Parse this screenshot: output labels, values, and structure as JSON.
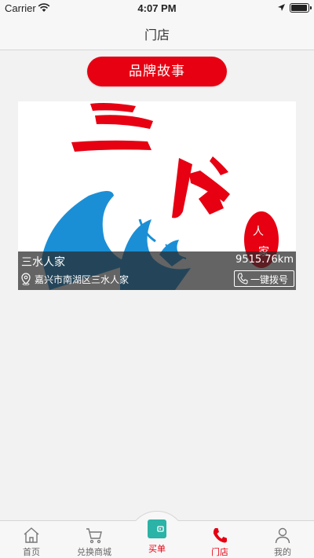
{
  "status_bar": {
    "carrier": "Carrier",
    "time": "4:07 PM"
  },
  "nav": {
    "title": "门店"
  },
  "brand_story_button": "品牌故事",
  "store": {
    "name": "三水人家",
    "distance": "9515.76km",
    "address": "嘉兴市南湖区三水人家",
    "call_label": "一键拨号",
    "logo_text": {
      "main": "三水",
      "seal": "人家"
    }
  },
  "tabs": [
    {
      "label": "首页",
      "icon": "home-icon"
    },
    {
      "label": "兑换商城",
      "icon": "cart-icon"
    },
    {
      "label": "买单",
      "icon": "wallet-icon"
    },
    {
      "label": "门店",
      "icon": "phone-icon",
      "active": true
    },
    {
      "label": "我的",
      "icon": "user-icon"
    }
  ],
  "colors": {
    "accent": "#e60012",
    "wallet": "#2ab3a6",
    "logo_blue": "#1b8fd6"
  }
}
